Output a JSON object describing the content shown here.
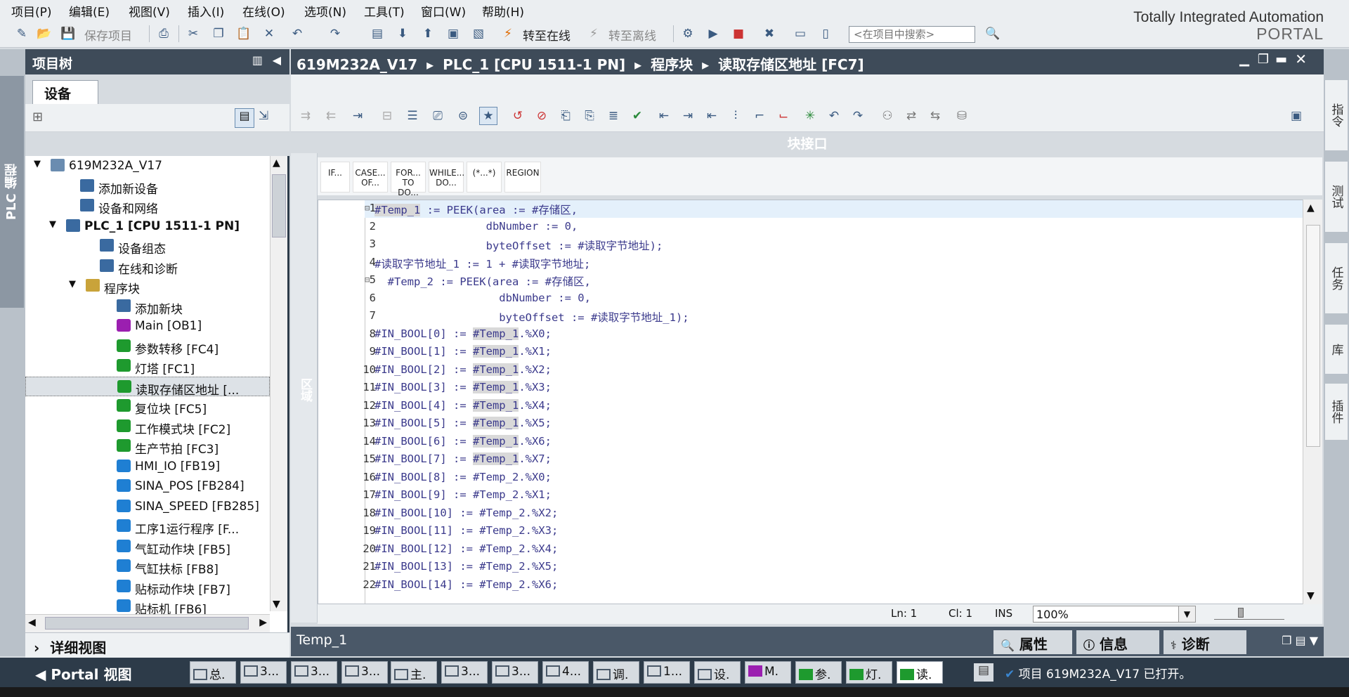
{
  "menu": [
    "项目(P)",
    "编辑(E)",
    "视图(V)",
    "插入(I)",
    "在线(O)",
    "选项(N)",
    "工具(T)",
    "窗口(W)",
    "帮助(H)"
  ],
  "toolbar": {
    "save_project": "保存项目",
    "go_online": "转至在线",
    "go_offline": "转至离线",
    "search_placeholder": "<在项目中搜索>"
  },
  "brand": {
    "line1": "Totally Integrated Automation",
    "line2": "PORTAL"
  },
  "left_vtab": "PLC 编程",
  "project_tree": {
    "title": "项目树",
    "tab": "设备",
    "items": [
      {
        "label": "619M232A_V17",
        "icon": "project-icon"
      },
      {
        "label": "添加新设备",
        "icon": "add-device-icon"
      },
      {
        "label": "设备和网络",
        "icon": "network-icon"
      },
      {
        "label": "PLC_1 [CPU 1511-1 PN]",
        "icon": "plc-icon"
      },
      {
        "label": "设备组态",
        "icon": "device-config-icon"
      },
      {
        "label": "在线和诊断",
        "icon": "diagnostics-icon"
      },
      {
        "label": "程序块",
        "icon": "folder-icon"
      },
      {
        "label": "添加新块",
        "icon": "add-block-icon"
      },
      {
        "label": "Main [OB1]",
        "icon": "ob-icon"
      },
      {
        "label": "参数转移 [FC4]",
        "icon": "fc-icon"
      },
      {
        "label": "灯塔 [FC1]",
        "icon": "fc-icon"
      },
      {
        "label": "读取存储区地址 [...",
        "icon": "fc-icon"
      },
      {
        "label": "复位块 [FC5]",
        "icon": "fc-icon"
      },
      {
        "label": "工作模式块 [FC2]",
        "icon": "fc-icon"
      },
      {
        "label": "生产节拍 [FC3]",
        "icon": "fc-icon"
      },
      {
        "label": "HMI_IO [FB19]",
        "icon": "fb-icon"
      },
      {
        "label": "SINA_POS [FB284]",
        "icon": "fb-icon"
      },
      {
        "label": "SINA_SPEED [FB285]",
        "icon": "fb-icon"
      },
      {
        "label": "工序1运行程序 [F...",
        "icon": "fb-icon"
      },
      {
        "label": "气缸动作块 [FB5]",
        "icon": "fb-icon"
      },
      {
        "label": "气缸扶标 [FB8]",
        "icon": "fb-icon"
      },
      {
        "label": "贴标动作块 [FB7]",
        "icon": "fb-icon"
      },
      {
        "label": "贴标机 [FB6]",
        "icon": "fb-icon"
      }
    ],
    "detail_view": "详细视图"
  },
  "editor": {
    "breadcrumb": [
      "619M232A_V17",
      "PLC_1 [CPU 1511-1 PN]",
      "程序块",
      "读取存储区地址 [FC7]"
    ],
    "block_interface": "块接口",
    "left_mini_label": "区域",
    "templates": [
      "IF...",
      "CASE... OF...",
      "FOR... TO DO...",
      "WHILE... DO...",
      "(*...*)",
      "REGION"
    ],
    "code_lines": [
      {
        "n": "1",
        "pre": "",
        "hv": "#Temp_1",
        "post": " := PEEK(area := #存储区,"
      },
      {
        "n": "2",
        "pre": "                 dbNumber := 0,",
        "hv": "",
        "post": ""
      },
      {
        "n": "3",
        "pre": "                 byteOffset := #读取字节地址);",
        "hv": "",
        "post": ""
      },
      {
        "n": "4",
        "pre": "#读取字节地址_1 := 1 + #读取字节地址;",
        "hv": "",
        "post": ""
      },
      {
        "n": "5",
        "pre": "  #Temp_2 := PEEK(area := #存储区,",
        "hv": "",
        "post": ""
      },
      {
        "n": "6",
        "pre": "                   dbNumber := 0,",
        "hv": "",
        "post": ""
      },
      {
        "n": "7",
        "pre": "                   byteOffset := #读取字节地址_1);",
        "hv": "",
        "post": ""
      },
      {
        "n": "8",
        "pre": "#IN_BOOL[0] := ",
        "hv": "#Temp_1",
        "post": ".%X0;"
      },
      {
        "n": "9",
        "pre": "#IN_BOOL[1] := ",
        "hv": "#Temp_1",
        "post": ".%X1;"
      },
      {
        "n": "10",
        "pre": "#IN_BOOL[2] := ",
        "hv": "#Temp_1",
        "post": ".%X2;"
      },
      {
        "n": "11",
        "pre": "#IN_BOOL[3] := ",
        "hv": "#Temp_1",
        "post": ".%X3;"
      },
      {
        "n": "12",
        "pre": "#IN_BOOL[4] := ",
        "hv": "#Temp_1",
        "post": ".%X4;"
      },
      {
        "n": "13",
        "pre": "#IN_BOOL[5] := ",
        "hv": "#Temp_1",
        "post": ".%X5;"
      },
      {
        "n": "14",
        "pre": "#IN_BOOL[6] := ",
        "hv": "#Temp_1",
        "post": ".%X6;"
      },
      {
        "n": "15",
        "pre": "#IN_BOOL[7] := ",
        "hv": "#Temp_1",
        "post": ".%X7;"
      },
      {
        "n": "16",
        "pre": "#IN_BOOL[8] := #Temp_2.%X0;",
        "hv": "",
        "post": ""
      },
      {
        "n": "17",
        "pre": "#IN_BOOL[9] := #Temp_2.%X1;",
        "hv": "",
        "post": ""
      },
      {
        "n": "18",
        "pre": "#IN_BOOL[10] := #Temp_2.%X2;",
        "hv": "",
        "post": ""
      },
      {
        "n": "19",
        "pre": "#IN_BOOL[11] := #Temp_2.%X3;",
        "hv": "",
        "post": ""
      },
      {
        "n": "20",
        "pre": "#IN_BOOL[12] := #Temp_2.%X4;",
        "hv": "",
        "post": ""
      },
      {
        "n": "21",
        "pre": "#IN_BOOL[13] := #Temp_2.%X5;",
        "hv": "",
        "post": ""
      },
      {
        "n": "22",
        "pre": "#IN_BOOL[14] := #Temp_2.%X6;",
        "hv": "",
        "post": ""
      }
    ],
    "status": {
      "ln": "Ln: 1",
      "cl": "Cl: 1",
      "mode": "INS",
      "zoom": "100%"
    }
  },
  "properties": {
    "title": "Temp_1",
    "tabs": [
      "属性",
      "信息",
      "诊断"
    ]
  },
  "right_tabs": [
    "指令",
    "测试",
    "任务",
    "库",
    "插件"
  ],
  "taskbar": {
    "portal_view": "Portal 视图",
    "items": [
      "总.",
      "3...",
      "3...",
      "3...",
      "主.",
      "3...",
      "3...",
      "4...",
      "调.",
      "1...",
      "设.",
      "M.",
      "参.",
      "灯.",
      "读."
    ],
    "status": "项目 619M232A_V17 已打开。"
  },
  "colors": {
    "accent": "#3e4b59",
    "code": "#3b3a8c",
    "fc": "#1e9a2e",
    "fb": "#1f7fd3",
    "ob": "#9b1fb0"
  }
}
